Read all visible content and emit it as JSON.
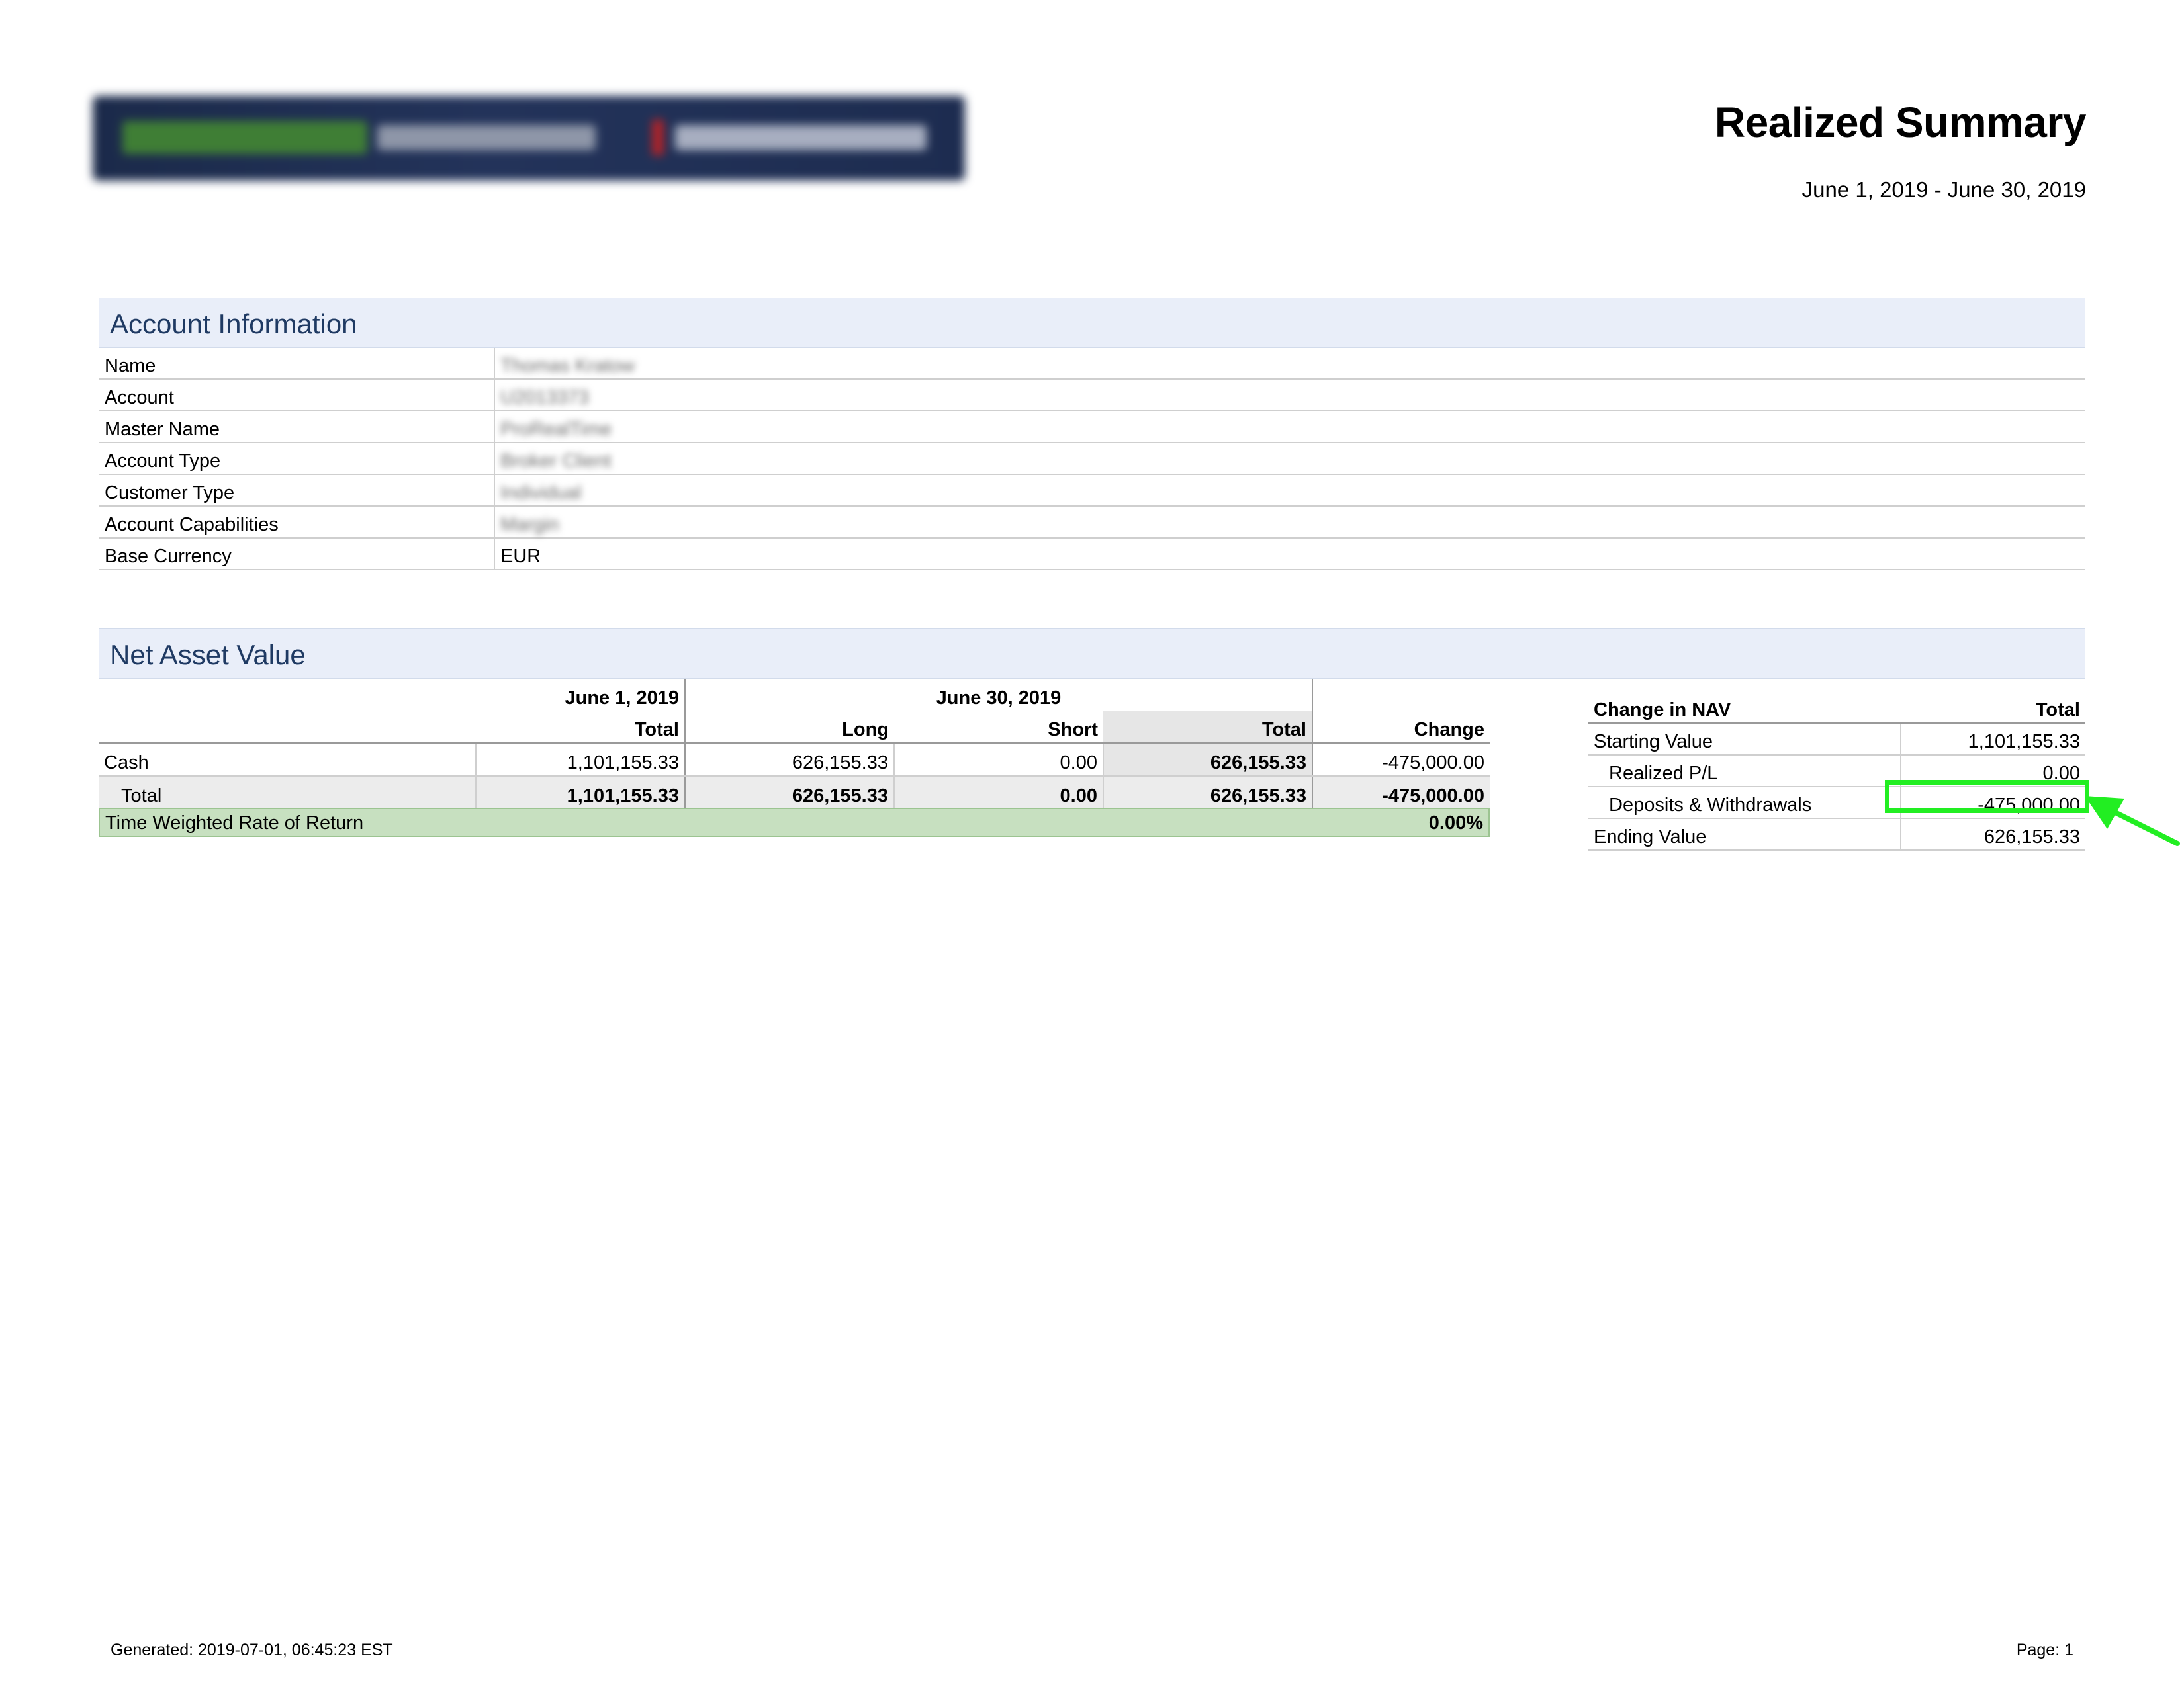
{
  "header": {
    "logo_label": "ProRealTime / Interactive Brokers logo",
    "title": "Realized Summary",
    "period": "June 1, 2019 - June 30, 2019"
  },
  "account_information": {
    "heading": "Account Information",
    "rows": [
      {
        "label": "Name",
        "value": "Thomas Kratow"
      },
      {
        "label": "Account",
        "value": "U2013373"
      },
      {
        "label": "Master Name",
        "value": "ProRealTime"
      },
      {
        "label": "Account Type",
        "value": "Broker Client"
      },
      {
        "label": "Customer Type",
        "value": "Individual"
      },
      {
        "label": "Account Capabilities",
        "value": "Margin"
      },
      {
        "label": "Base Currency",
        "value": "EUR"
      }
    ]
  },
  "net_asset_value": {
    "heading": "Net Asset Value",
    "period_start": "June 1, 2019",
    "period_end": "June 30, 2019",
    "columns": [
      "Total",
      "Long",
      "Short",
      "Total",
      "Change"
    ],
    "rows": [
      {
        "label": "Cash",
        "start_total": "1,101,155.33",
        "long": "626,155.33",
        "short": "0.00",
        "end_total": "626,155.33",
        "change": "-475,000.00"
      },
      {
        "label": "Total",
        "start_total": "1,101,155.33",
        "long": "626,155.33",
        "short": "0.00",
        "end_total": "626,155.33",
        "change": "-475,000.00"
      }
    ],
    "twrr_label": "Time Weighted Rate of Return",
    "twrr_value": "0.00%"
  },
  "change_in_nav": {
    "header_label": "Change in NAV",
    "header_total": "Total",
    "rows": [
      {
        "label": "Starting Value",
        "value": "1,101,155.33"
      },
      {
        "label": "Realized P/L",
        "value": "0.00"
      },
      {
        "label": "Deposits & Withdrawals",
        "value": "-475,000.00"
      },
      {
        "label": "Ending Value",
        "value": "626,155.33"
      }
    ]
  },
  "annotation": {
    "highlight_color": "#22ee22"
  },
  "footer": {
    "generated": "Generated: 2019-07-01, 06:45:23 EST",
    "page": "Page: 1"
  }
}
